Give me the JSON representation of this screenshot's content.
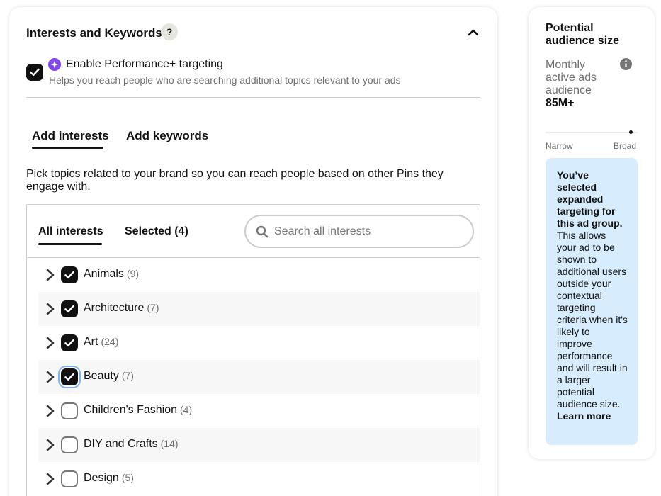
{
  "section": {
    "title": "Interests and Keywords",
    "help_label": "?"
  },
  "performance_plus": {
    "label": "Enable Performance+ targeting",
    "help": "Helps you reach people who are searching additional topics relevant to your ads",
    "checked": true
  },
  "tabs": [
    {
      "label": "Add interests",
      "active": true
    },
    {
      "label": "Add keywords",
      "active": false
    }
  ],
  "description": "Pick topics related to your brand so you can reach people based on other Pins they engage with.",
  "interest_browser": {
    "subtabs": [
      {
        "label": "All interests",
        "active": true
      },
      {
        "label": "Selected (4)",
        "active": false
      }
    ],
    "search": {
      "placeholder": "Search all interests",
      "value": ""
    },
    "rows": [
      {
        "label": "Animals",
        "count": "(9)",
        "checked": true
      },
      {
        "label": "Architecture",
        "count": "(7)",
        "checked": true
      },
      {
        "label": "Art",
        "count": "(24)",
        "checked": true
      },
      {
        "label": "Beauty",
        "count": "(7)",
        "checked": true,
        "focused": true
      },
      {
        "label": "Children's Fashion",
        "count": "(4)",
        "checked": false
      },
      {
        "label": "DIY and Crafts",
        "count": "(14)",
        "checked": false
      },
      {
        "label": "Design",
        "count": "(5)",
        "checked": false
      }
    ]
  },
  "audience": {
    "title": "Potential audience size",
    "metric_label": "Monthly active ads audience",
    "value": "85M+",
    "meter": {
      "min_label": "Narrow",
      "max_label": "Broad",
      "level": 0.93
    },
    "note": {
      "bold": "You’ve selected expanded targeting for this ad group.",
      "body": " This allows your ad to be shown to additional users outside your contextual targeting criteria when it's likely to improve performance and will result in a larger potential audience size. ",
      "link": "Learn more"
    }
  },
  "colors": {
    "checkbox_checked": "#111111",
    "note_background": "#d7ecfd",
    "sparkle_accent": "#8046e9",
    "focus_ring": "#7fb3ef"
  }
}
